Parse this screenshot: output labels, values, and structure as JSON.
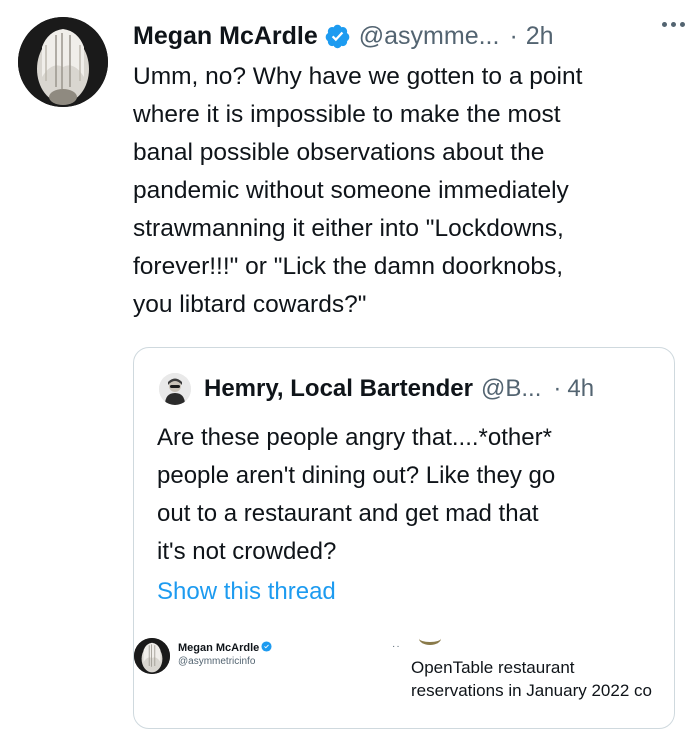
{
  "tweet": {
    "author_name": "Megan McArdle",
    "handle": "@asymme...",
    "separator": "·",
    "time": "2h",
    "text_lines": [
      "Umm, no? Why have we gotten to a point",
      "where it is impossible to make the most",
      "banal possible observations about the",
      "pandemic without someone immediately",
      "strawmanning it either into \"Lockdowns,",
      "forever!!!\" or \"Lick the damn doorknobs,",
      "you libtard cowards?\""
    ]
  },
  "quote": {
    "author_name": "Hemry, Local Bartender",
    "handle": "@B...",
    "separator": "·",
    "time": "4h",
    "text_lines": [
      "Are these people angry that....*other*",
      "people aren't dining out? Like they go",
      "out to a restaurant and get mad that",
      "it's not crowded?"
    ],
    "show_thread": "Show this thread"
  },
  "embedded_tweet": {
    "author_name": "Megan McArdle",
    "handle": "@asymmetricinfo",
    "dots": "··",
    "text_line_1": "OpenTable restaurant",
    "text_line_2": "reservations in January 2022 co"
  },
  "colors": {
    "link": "#1d9bf0",
    "verified": "#1d9bf0",
    "secondary_text": "#536471",
    "border": "#cfd9de"
  },
  "icons": {
    "verified": "verified-badge-icon",
    "more": "more-options-icon"
  }
}
